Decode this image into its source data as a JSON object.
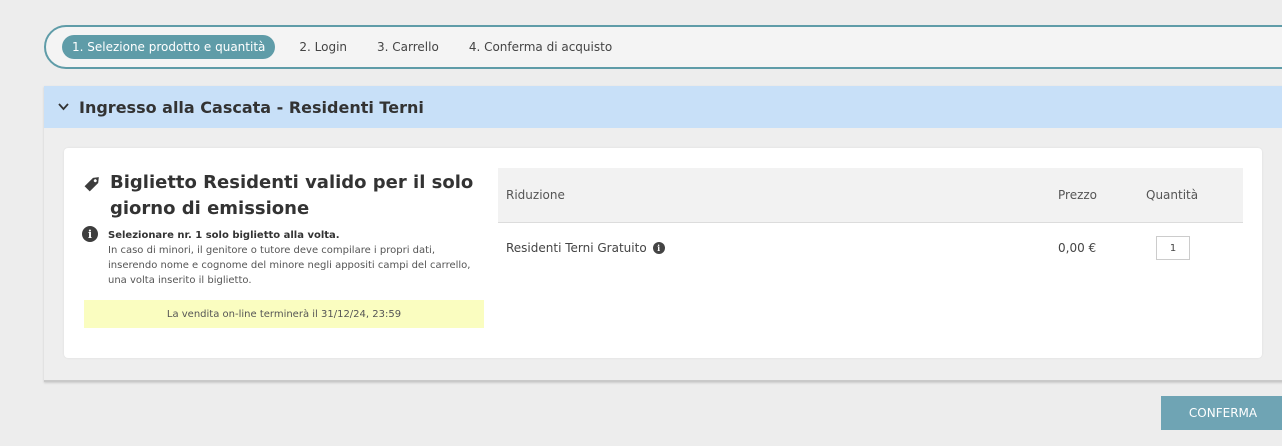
{
  "steps": [
    {
      "label": "1. Selezione prodotto e quantità",
      "active": true
    },
    {
      "label": "2. Login",
      "active": false
    },
    {
      "label": "3. Carrello",
      "active": false
    },
    {
      "label": "4. Conferma di acquisto",
      "active": false
    }
  ],
  "section": {
    "title": "Ingresso alla Cascata - Residenti Terni",
    "header_color": "#c8e0f8"
  },
  "ticket": {
    "title": "Biglietto Residenti valido per il solo giorno di emissione",
    "note_bold": "Selezionare nr. 1 solo biglietto alla volta.",
    "note_text": "In caso di minori, il genitore o tutore deve compilare i propri dati, inserendo nome e cognome del minore negli appositi campi del carrello, una volta inserito il biglietto.",
    "sale_end": "La vendita on-line terminerà il 31/12/24, 23:59"
  },
  "table": {
    "headers": {
      "riduzione": "Riduzione",
      "prezzo": "Prezzo",
      "quantita": "Quantità"
    },
    "rows": [
      {
        "riduzione": "Residenti Terni Gratuito",
        "prezzo": "0,00 €",
        "quantita": "1"
      }
    ]
  },
  "actions": {
    "confirm_label": "CONFERMA"
  },
  "colors": {
    "accent": "#5f9ca8",
    "banner": "#fafdc0",
    "button": "#6fa4b4"
  }
}
